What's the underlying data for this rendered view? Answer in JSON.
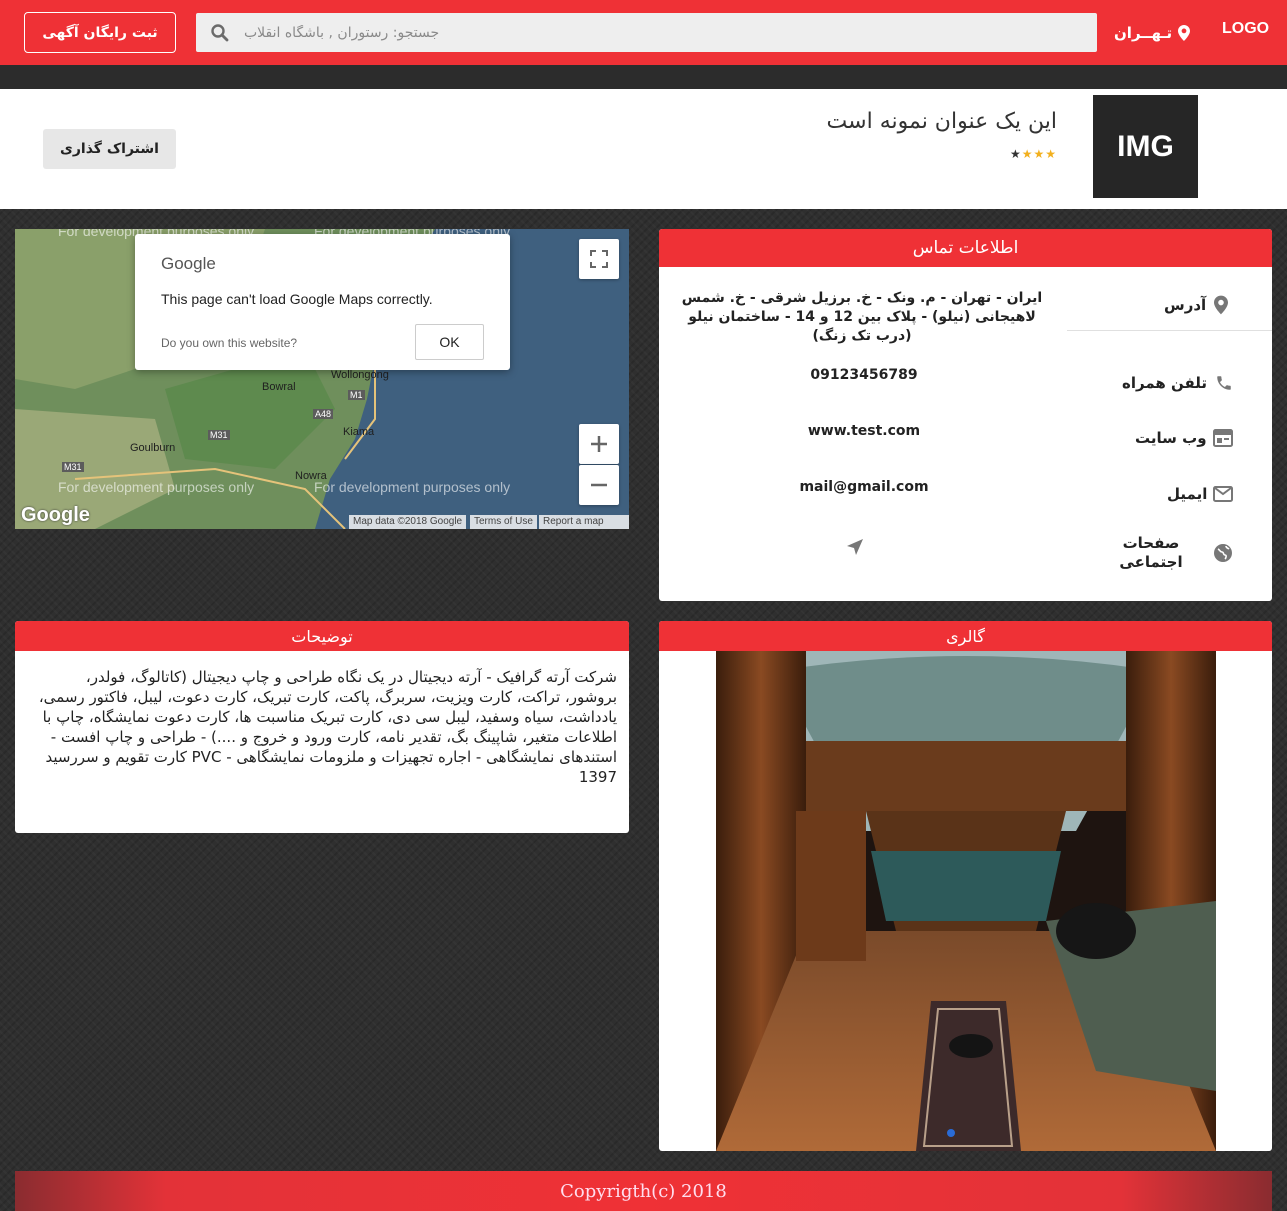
{
  "header": {
    "register_label": "ثبت رایگان آگهی",
    "search_placeholder": "جستجو: رستوران , باشگاه انقلاب",
    "city": "تـهــران",
    "logo": "LOGO"
  },
  "listing": {
    "img_label": "IMG",
    "title": "این یک عنوان نمونه است",
    "stars_full": "★★★",
    "stars_empty": "★",
    "share_label": "اشتراک گذاری"
  },
  "map": {
    "dev_text": "For development purposes only",
    "dialog_brand": "Google",
    "dialog_message": "This page can't load Google Maps correctly.",
    "dialog_owner": "Do you own this website?",
    "dialog_ok": "OK",
    "places": [
      "Wollongong",
      "Bowral",
      "Kiama",
      "Goulburn",
      "Nowra"
    ],
    "roads": [
      "M1",
      "A48",
      "M31",
      "M31"
    ],
    "attribution": {
      "data": "Map data ©2018 Google",
      "terms": "Terms of Use",
      "report": "Report a map error"
    },
    "google_logo": "Google"
  },
  "contact": {
    "header": "اطلاعات تماس",
    "address_label": "آدرس",
    "address_value": "ایران - تهران - م. ونک - خ. برزیل شرقی - خ. شمس لاهیجانی (نیلو) - پلاک بین 12 و 14 - ساختمان نیلو (درب تک زنگ)",
    "phone_label": "تلفن همراه",
    "phone_value": "09123456789",
    "website_label": "وب سایت",
    "website_value": "www.test.com",
    "email_label": "ایمیل",
    "email_value": "mail@gmail.com",
    "social_label": "صفحات اجتماعی"
  },
  "description": {
    "header": "توضیحات",
    "text": "شرکت آرته گرافیک - آرته دیجیتال در یک نگاه طراحی و چاپ دیجیتال (کاتالوگ، فولدر، بروشور، تراکت، کارت ویزیت، سربرگ، پاکت، کارت تبریک، کارت دعوت، لیبل، فاکتور رسمی، یادداشت، سیاه وسفید، لیبل سی دی، کارت تبریک مناسبت ها، کارت دعوت نمایشگاه، چاپ با اطلاعات متغیر، شاپینگ بگ، تقدیر نامه، کارت ورود و خروج و ....) - طراحی و چاپ افست - استندهای نمایشگاهی - اجاره تجهیزات و ملزومات نمایشگاهی - PVC کارت تقویم و سررسید 1397"
  },
  "gallery": {
    "header": "گالری"
  },
  "footer": {
    "copyright": "Copyrigth(c) 2018"
  },
  "colors": {
    "brand_red": "#ef3136",
    "star_gold": "#f2b01e"
  }
}
